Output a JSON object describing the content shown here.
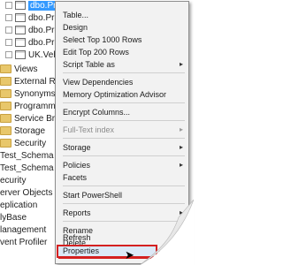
{
  "tree": {
    "items": [
      {
        "label": "dbo.Product",
        "type": "table",
        "selected": true
      },
      {
        "label": "dbo.Pro",
        "type": "table"
      },
      {
        "label": "dbo.Pro",
        "type": "table"
      },
      {
        "label": "dbo.Pro",
        "type": "table"
      },
      {
        "label": "UK.Veh",
        "type": "table"
      },
      {
        "label": "Views",
        "type": "folder"
      },
      {
        "label": "External R",
        "type": "folder"
      },
      {
        "label": "Synonyms",
        "type": "folder"
      },
      {
        "label": "Programm",
        "type": "folder"
      },
      {
        "label": "Service Br",
        "type": "folder"
      },
      {
        "label": "Storage",
        "type": "folder"
      },
      {
        "label": "Security",
        "type": "folder"
      },
      {
        "label": "Test_Schema",
        "type": "folder"
      },
      {
        "label": "Test_Schema",
        "type": "folder"
      },
      {
        "label": "ecurity",
        "type": "folder"
      },
      {
        "label": "erver Objects",
        "type": "folder"
      },
      {
        "label": "eplication",
        "type": "folder"
      },
      {
        "label": "lyBase",
        "type": "folder"
      },
      {
        "label": "lanagement",
        "type": "folder"
      },
      {
        "label": "vent Profiler",
        "type": "folder"
      }
    ]
  },
  "menu": {
    "items": [
      {
        "label": "Table..."
      },
      {
        "label": "Design"
      },
      {
        "label": "Select Top 1000 Rows"
      },
      {
        "label": "Edit Top 200 Rows"
      },
      {
        "label": "Script Table as",
        "submenu": true
      },
      {
        "label": "View Dependencies"
      },
      {
        "label": "Memory Optimization Advisor"
      },
      {
        "label": "Encrypt Columns..."
      },
      {
        "label": "Full-Text index",
        "submenu": true,
        "disabled": true
      },
      {
        "label": "Storage",
        "submenu": true
      },
      {
        "label": "Policies",
        "submenu": true
      },
      {
        "label": "Facets"
      },
      {
        "label": "Start PowerShell"
      },
      {
        "label": "Reports",
        "submenu": true
      },
      {
        "label": "Rename"
      },
      {
        "label": "Delete"
      },
      {
        "label": "Refresh"
      },
      {
        "label": "Properties",
        "highlighted": true
      }
    ]
  },
  "icons": {
    "submenu_arrow": "chevron-right-icon",
    "highlight_color": "#d42020"
  }
}
